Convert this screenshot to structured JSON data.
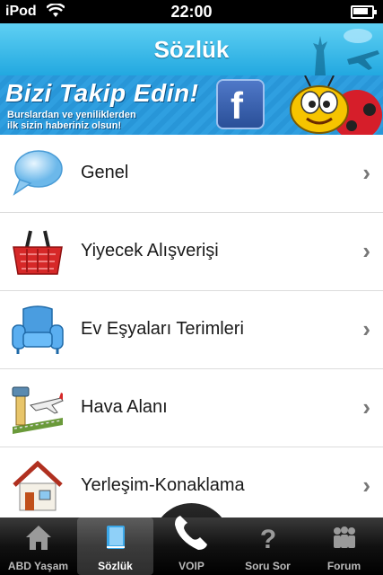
{
  "status": {
    "carrier": "iPod",
    "time": "22:00"
  },
  "nav": {
    "title": "Sözlük"
  },
  "banner": {
    "headline": "Bizi Takip Edin!",
    "sub_line1": "Burslardan ve yeniliklerden",
    "sub_line2": "ilk sizin haberiniz olsun!",
    "fb_letter": "f"
  },
  "list": [
    {
      "label": "Genel",
      "icon": "speech-bubble-icon"
    },
    {
      "label": "Yiyecek Alışverişi",
      "icon": "shopping-basket-icon"
    },
    {
      "label": "Ev Eşyaları Terimleri",
      "icon": "armchair-icon"
    },
    {
      "label": "Hava Alanı",
      "icon": "airport-icon"
    },
    {
      "label": "Yerleşim-Konaklama",
      "icon": "house-icon"
    }
  ],
  "tabs": [
    {
      "label": "ABD Yaşam",
      "icon": "home-icon",
      "active": false
    },
    {
      "label": "Sözlük",
      "icon": "book-icon",
      "active": true
    },
    {
      "label": "VOIP",
      "icon": "phone-icon",
      "active": false
    },
    {
      "label": "Soru Sor",
      "icon": "question-icon",
      "active": false
    },
    {
      "label": "Forum",
      "icon": "people-icon",
      "active": false
    }
  ],
  "colors": {
    "nav_blue": "#22a8e0",
    "banner_blue": "#2896d8"
  }
}
